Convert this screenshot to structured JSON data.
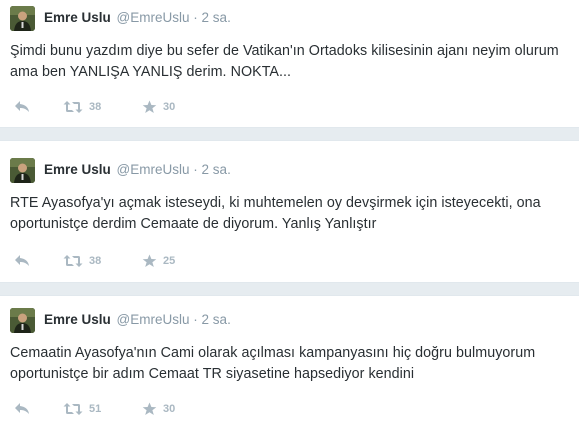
{
  "tweets": [
    {
      "name": "Emre Uslu",
      "handle": "@EmreUslu",
      "separator": "·",
      "time": "2 sa.",
      "text": "Şimdi bunu yazdım diye bu sefer de Vatikan'ın Ortadoks kilisesinin ajanı neyim olurum ama ben YANLIŞA YANLIŞ derim. NOKTA...",
      "retweets": "38",
      "favorites": "30"
    },
    {
      "name": "Emre Uslu",
      "handle": "@EmreUslu",
      "separator": "·",
      "time": "2 sa.",
      "text": "RTE Ayasofya'yı açmak isteseydi, ki muhtemelen oy devşirmek için isteyecekti, ona oportunistçe derdim Cemaate de diyorum. Yanlış Yanlıştır",
      "retweets": "38",
      "favorites": "25"
    },
    {
      "name": "Emre Uslu",
      "handle": "@EmreUslu",
      "separator": "·",
      "time": "2 sa.",
      "text": "Cemaatin Ayasofya'nın Cami olarak açılması kampanyasını hiç doğru bulmuyorum oportunistçe bir adım Cemaat TR siyasetine hapsediyor kendini",
      "retweets": "51",
      "favorites": "30"
    }
  ],
  "icons": {
    "reply": "reply-icon",
    "retweet": "retweet-icon",
    "favorite": "star-icon"
  },
  "colors": {
    "background": "#e6ecf0",
    "card": "#ffffff",
    "text": "#292f33",
    "muted": "#8899a6",
    "action": "#aab8c2"
  }
}
